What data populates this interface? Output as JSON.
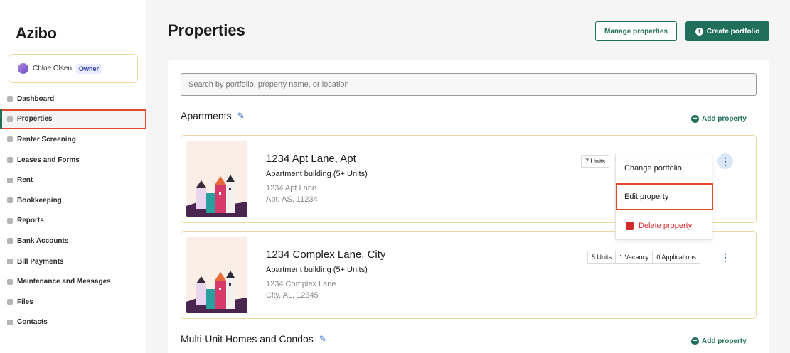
{
  "brand": {
    "logo_text": "Azibo"
  },
  "user": {
    "name": "Chloe Olsen",
    "role": "Owner"
  },
  "sidebar": {
    "items": [
      {
        "label": "Dashboard",
        "icon": "home-icon"
      },
      {
        "label": "Properties",
        "icon": "building-icon",
        "active": true
      },
      {
        "label": "Renter Screening",
        "icon": "screening-icon"
      },
      {
        "label": "Leases and Forms",
        "icon": "document-icon"
      },
      {
        "label": "Rent",
        "icon": "rent-icon"
      },
      {
        "label": "Bookkeeping",
        "icon": "book-icon"
      },
      {
        "label": "Reports",
        "icon": "report-icon"
      },
      {
        "label": "Bank Accounts",
        "icon": "bank-icon"
      },
      {
        "label": "Bill Payments",
        "icon": "bill-icon"
      },
      {
        "label": "Maintenance and Messages",
        "icon": "wrench-icon"
      },
      {
        "label": "Files",
        "icon": "file-icon"
      },
      {
        "label": "Contacts",
        "icon": "contact-icon"
      }
    ]
  },
  "header": {
    "title": "Properties",
    "manage_label": "Manage properties",
    "create_label": "Create portfolio"
  },
  "search": {
    "placeholder": "Search by portfolio, property name, or location"
  },
  "sections": [
    {
      "title": "Apartments",
      "add_label": "Add property",
      "properties": [
        {
          "title": "1234 Apt Lane, Apt",
          "type": "Apartment building (5+ Units)",
          "address1": "1234 Apt Lane",
          "address2": "Apt, AS, 11234",
          "stats": [
            "7 Units"
          ]
        },
        {
          "title": "1234 Complex Lane, City",
          "type": "Apartment building (5+ Units)",
          "address1": "1234 Complex Lane",
          "address2": "City, AL, 12345",
          "stats": [
            "5 Units",
            "1 Vacancy",
            "0 Applications"
          ]
        }
      ]
    },
    {
      "title": "Multi-Unit Homes and Condos",
      "add_label": "Add property"
    }
  ],
  "context_menu": {
    "change_portfolio": "Change portfolio",
    "edit_property": "Edit property",
    "delete_property": "Delete property"
  },
  "colors": {
    "accent": "#1f6f5a",
    "danger": "#d42b2b",
    "link": "#2b67c9",
    "highlight": "#e24a2a"
  }
}
